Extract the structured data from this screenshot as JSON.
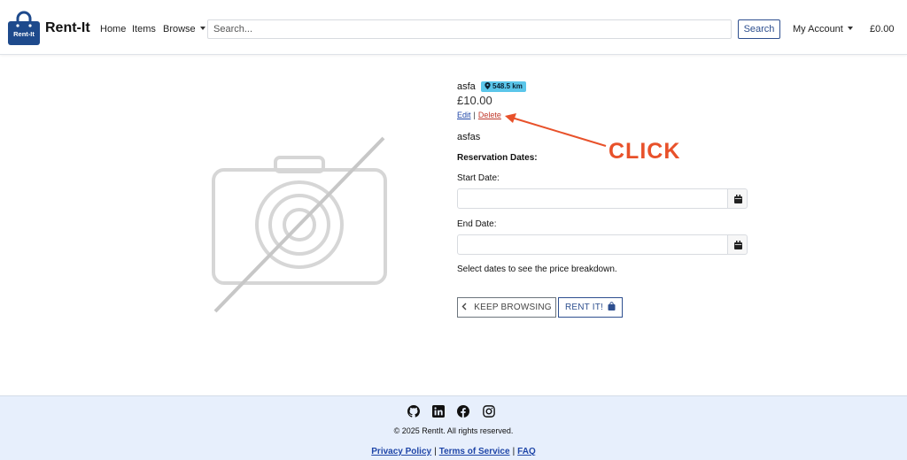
{
  "navbar": {
    "logo_text": "Rent-It",
    "brand": "Rent-It",
    "home": "Home",
    "items": "Items",
    "browse": "Browse",
    "search_placeholder": "Search...",
    "search_button": "Search",
    "account": "My Account",
    "cart_total": "£0.00",
    "brand_color": "#1e4a8c"
  },
  "product": {
    "title": "asfa",
    "distance": "548.5 km",
    "price": "£10.00",
    "edit_label": "Edit",
    "separator": "|",
    "delete_label": "Delete",
    "description": "asfas",
    "image_icon": "no-image-camera-icon"
  },
  "reservation": {
    "heading": "Reservation Dates:",
    "start_label": "Start Date:",
    "start_value": "",
    "end_label": "End Date:",
    "end_value": "",
    "helper_text": "Select dates to see the price breakdown."
  },
  "actions": {
    "keep_browsing": "KEEP BROWSING",
    "rent_it": "RENT IT!"
  },
  "annotation": {
    "text": "CLICK",
    "color": "#e8512a"
  },
  "footer": {
    "copyright": "© 2025 RentIt. All rights reserved.",
    "privacy": "Privacy Policy",
    "terms": "Terms of Service",
    "faq": "FAQ",
    "separator": "|",
    "background": "#e7effc"
  }
}
